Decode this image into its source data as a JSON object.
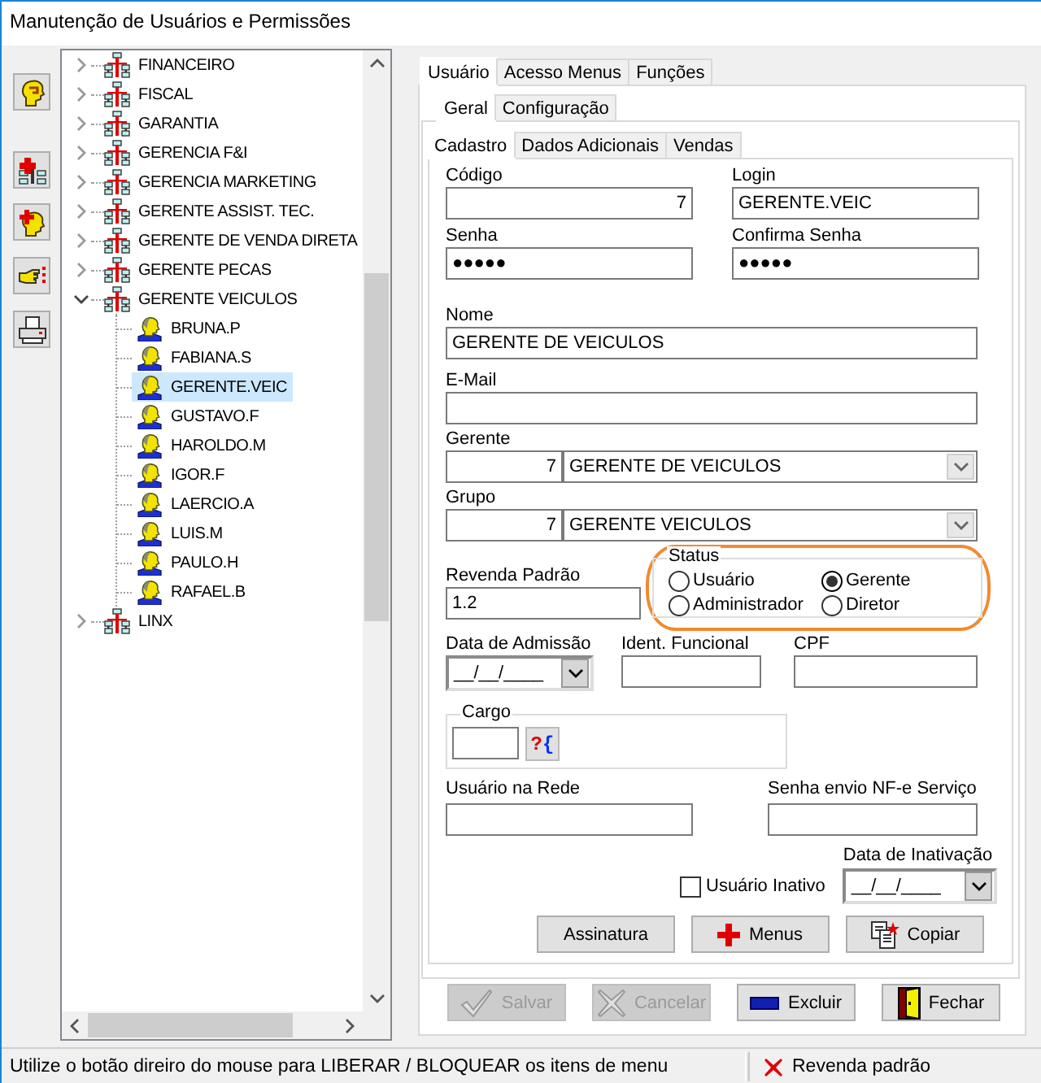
{
  "window": {
    "title": "Manutenção de Usuários e Permissões"
  },
  "tree": {
    "groups": [
      {
        "label": "FINANCEIRO",
        "expanded": false
      },
      {
        "label": "FISCAL",
        "expanded": false
      },
      {
        "label": "GARANTIA",
        "expanded": false
      },
      {
        "label": "GERENCIA F&I",
        "expanded": false
      },
      {
        "label": "GERENCIA MARKETING",
        "expanded": false
      },
      {
        "label": "GERENTE ASSIST. TEC.",
        "expanded": false
      },
      {
        "label": "GERENTE DE VENDA DIRETA",
        "expanded": false
      },
      {
        "label": "GERENTE PECAS",
        "expanded": false
      },
      {
        "label": "GERENTE VEICULOS",
        "expanded": true,
        "children": [
          {
            "label": "BRUNA.P",
            "selected": false
          },
          {
            "label": "FABIANA.S",
            "selected": false
          },
          {
            "label": "GERENTE.VEIC",
            "selected": true
          },
          {
            "label": "GUSTAVO.F",
            "selected": false
          },
          {
            "label": "HAROLDO.M",
            "selected": false
          },
          {
            "label": "IGOR.F",
            "selected": false
          },
          {
            "label": "LAERCIO.A",
            "selected": false
          },
          {
            "label": "LUIS.M",
            "selected": false
          },
          {
            "label": "PAULO.H",
            "selected": false
          },
          {
            "label": "RAFAEL.B",
            "selected": false
          }
        ]
      },
      {
        "label": "LINX",
        "expanded": false
      }
    ]
  },
  "tabs": [
    {
      "label": "Usuário",
      "selected": true
    },
    {
      "label": "Acesso Menus",
      "selected": false
    },
    {
      "label": "Funções",
      "selected": false
    }
  ],
  "subtabs": [
    {
      "label": "Geral",
      "selected": true
    },
    {
      "label": "Configuração",
      "selected": false
    }
  ],
  "form_tabs": [
    {
      "label": "Cadastro",
      "selected": true
    },
    {
      "label": "Dados Adicionais",
      "selected": false
    },
    {
      "label": "Vendas",
      "selected": false
    }
  ],
  "form": {
    "codigo": {
      "label": "Código",
      "value": "7"
    },
    "login": {
      "label": "Login",
      "value": "GERENTE.VEIC"
    },
    "senha": {
      "label": "Senha",
      "value": "●●●●●"
    },
    "confirma_senha": {
      "label": "Confirma Senha",
      "value": "●●●●●"
    },
    "nome": {
      "label": "Nome",
      "value": "GERENTE DE VEICULOS"
    },
    "email": {
      "label": "E-Mail"
    },
    "gerente": {
      "label": "Gerente",
      "code": "7",
      "value": "GERENTE DE VEICULOS"
    },
    "grupo": {
      "label": "Grupo",
      "code": "7",
      "value": "GERENTE VEICULOS"
    },
    "revenda_padrao": {
      "label": "Revenda Padrão",
      "value": "1.2"
    },
    "status": {
      "title": "Status",
      "highlighted": true,
      "options": [
        {
          "label": "Usuário",
          "selected": false
        },
        {
          "label": "Gerente",
          "selected": true
        },
        {
          "label": "Administrador",
          "selected": false
        },
        {
          "label": "Diretor",
          "selected": false
        }
      ]
    },
    "data_admissao": {
      "label": "Data de Admissão",
      "value": "__/__/____"
    },
    "ident_funcional": {
      "label": "Ident. Funcional"
    },
    "cpf": {
      "label": "CPF"
    },
    "cargo": {
      "label": "Cargo",
      "lookup": "?{"
    },
    "usuario_rede": {
      "label": "Usuário na Rede"
    },
    "senha_nfe": {
      "label": "Senha envio NF-e Serviço"
    },
    "usuario_inativo": {
      "label": "Usuário Inativo",
      "checked": false
    },
    "data_inativacao": {
      "label": "Data de Inativação",
      "value": "__/__/____"
    },
    "buttons": [
      {
        "label": "Assinatura",
        "kind": "plain"
      },
      {
        "label": "Menus",
        "kind": "plus"
      },
      {
        "label": "Copiar",
        "kind": "copy"
      }
    ]
  },
  "actions": [
    {
      "label": "Salvar",
      "kind": "check",
      "disabled": true
    },
    {
      "label": "Cancelar",
      "kind": "cross",
      "disabled": true
    },
    {
      "label": "Excluir",
      "kind": "minus",
      "disabled": false
    },
    {
      "label": "Fechar",
      "kind": "door",
      "disabled": false
    }
  ],
  "status_bar": {
    "hint": "Utilize o botão direiro do mouse para LIBERAR / BLOQUEAR os itens de menu",
    "indicator": "Revenda padrão"
  }
}
